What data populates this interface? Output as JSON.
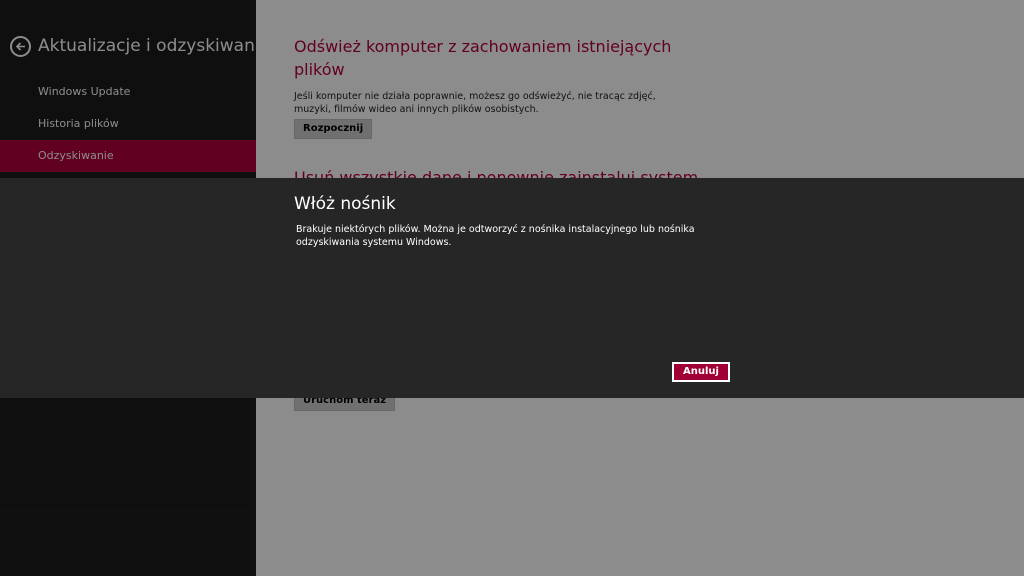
{
  "sidebar": {
    "title": "Aktualizacje i odzyskiwanie",
    "items": [
      {
        "label": "Windows Update"
      },
      {
        "label": "Historia plików"
      },
      {
        "label": "Odzyskiwanie"
      }
    ]
  },
  "main": {
    "refresh_section": {
      "title": "Odśwież komputer z zachowaniem istniejących plików",
      "description": "Jeśli komputer nie działa poprawnie, możesz go odświeżyć, nie tracąc zdjęć, muzyki, filmów wideo ani innych plików osobistych.",
      "button_label": "Rozpocznij"
    },
    "remove_section": {
      "title": "Usuń wszystkie dane i ponownie zainstaluj system"
    },
    "advanced_startup": {
      "button_label": "Uruchom teraz"
    }
  },
  "dialog": {
    "title": "Włóż nośnik",
    "body": "Brakuje niektórych plików. Można je odtworzyć z nośnika instalacyjnego lub nośnika odzyskiwania systemu Windows.",
    "cancel_label": "Anuluj"
  },
  "colors": {
    "accent": "#b3003c",
    "sidebar_bg": "#1d1d1d",
    "dialog_bg": "#262626"
  }
}
